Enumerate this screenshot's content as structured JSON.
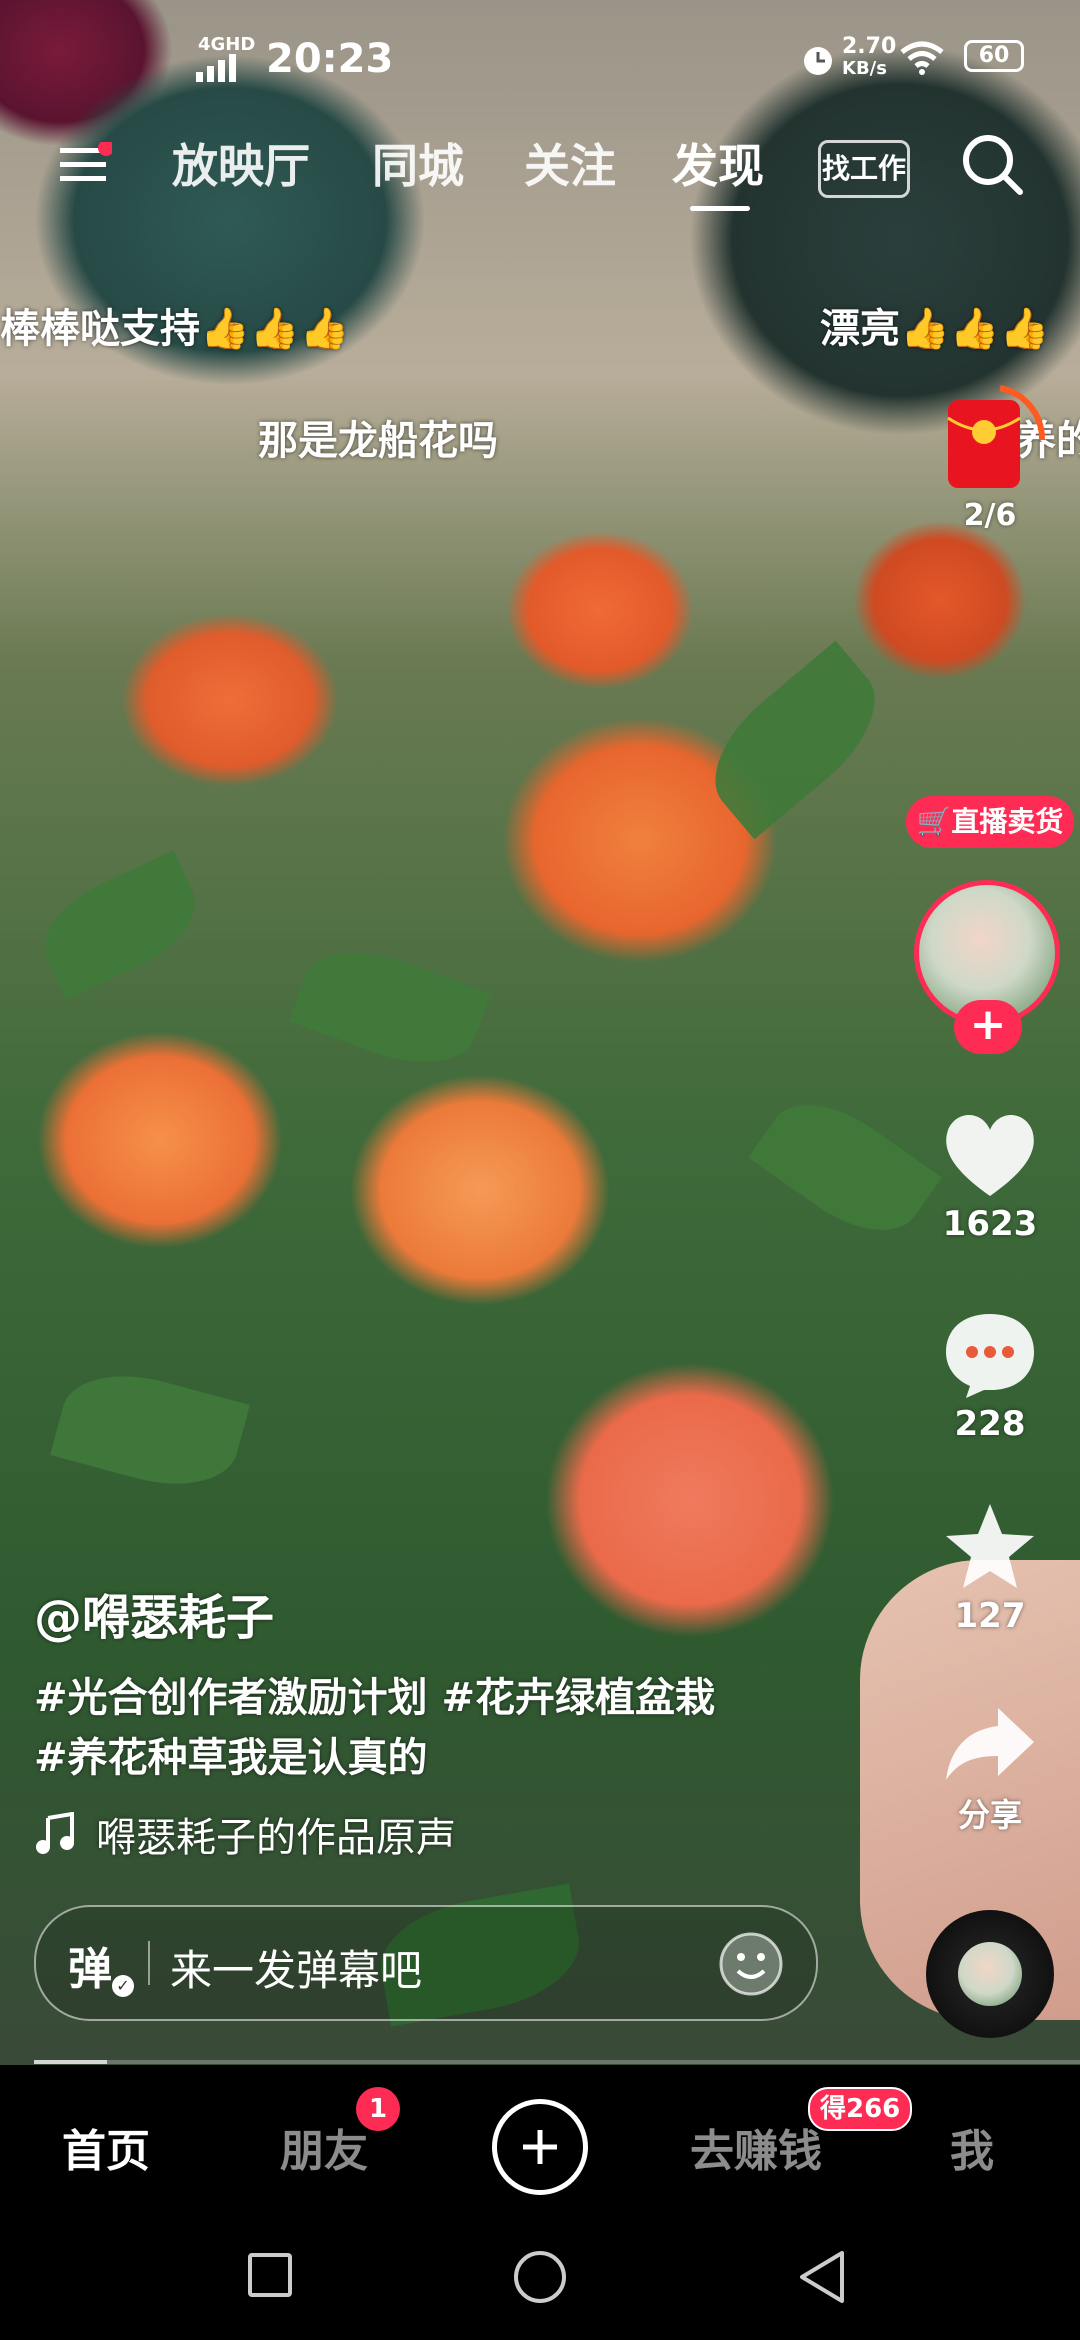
{
  "status_bar": {
    "network": "4GHD",
    "time": "20:23",
    "speed_value": "2.70",
    "speed_unit": "KB/s",
    "battery": "60"
  },
  "top_nav": {
    "tabs": [
      {
        "label": "放映厅",
        "active": false
      },
      {
        "label": "同城",
        "active": false
      },
      {
        "label": "关注",
        "active": false
      },
      {
        "label": "发现",
        "active": true
      }
    ],
    "work_label": "找工作"
  },
  "danmaku": [
    {
      "text": "棒棒哒支持👍👍👍"
    },
    {
      "text": "漂亮👍👍👍"
    },
    {
      "text": "那是龙船花吗"
    },
    {
      "text": "养的"
    }
  ],
  "red_packet": {
    "progress_label": "2/6"
  },
  "live_sell": {
    "label": "直播卖货"
  },
  "actions": {
    "likes": "1623",
    "comments": "228",
    "favorites": "127",
    "share_label": "分享"
  },
  "video_info": {
    "author": "@嘚瑟耗子",
    "tags_line1": "#光合创作者激励计划  #花卉绿植盆栽",
    "tags_line2": "#养花种草我是认真的",
    "music": "嘚瑟耗子的作品原声"
  },
  "comment_bar": {
    "danmu_toggle": "弹",
    "placeholder": "来一发弹幕吧"
  },
  "playback": {
    "progress_fraction": 0.07
  },
  "bottom_nav": {
    "home": "首页",
    "friends": "朋友",
    "friends_badge": "1",
    "earn": "去赚钱",
    "earn_badge": "得266",
    "me": "我"
  },
  "colors": {
    "accent_pink": "#fe2c55",
    "badge_red": "#fe2c55"
  }
}
